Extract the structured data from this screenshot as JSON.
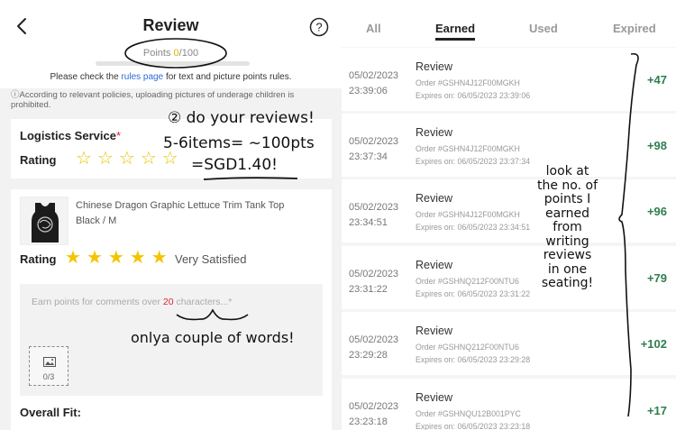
{
  "review_screen": {
    "title": "Review",
    "points_label": "Points",
    "points_value": "0",
    "points_max": "/100",
    "points_progress": 0,
    "rules_prefix": "Please check the",
    "rules_link": "rules page",
    "rules_suffix": "for text and picture points rules.",
    "notice": "ⓘAccording to relevant policies, uploading pictures of underage children is prohibited.",
    "logistics": {
      "label": "Logistics Service",
      "required": "*",
      "rating_label": "Rating",
      "stars": 0
    },
    "product": {
      "name": "Chinese Dragon Graphic Lettuce Trim Tank Top",
      "variant": "Black / M",
      "rating_label": "Rating",
      "stars": 5,
      "rating_text": "Very Satisfied",
      "comment_placeholder_prefix": "Earn points for comments over",
      "comment_placeholder_num": "20",
      "comment_placeholder_suffix": "characters...*",
      "upload_count": "0/3",
      "overall_fit": "Overall Fit:"
    }
  },
  "annotations": {
    "line1": "② do your reviews!",
    "line2": "5-6items= ~100pts",
    "line3": "=SGD1.40!",
    "line4": "onlya couple of words!",
    "note": [
      "look at",
      "the no. of",
      "points I",
      "earned",
      "from",
      "writing",
      "reviews",
      "in one",
      "seating!"
    ]
  },
  "points_history": {
    "tabs": [
      "All",
      "Earned",
      "Used",
      "Expired"
    ],
    "active_tab": "Earned",
    "rows": [
      {
        "date": "05/02/2023",
        "time": "23:39:06",
        "title": "Review",
        "order": "Order #GSHN4J12F00MGKH",
        "expires": "Expires on: 06/05/2023 23:39:06",
        "points": "+47"
      },
      {
        "date": "05/02/2023",
        "time": "23:37:34",
        "title": "Review",
        "order": "Order #GSHN4J12F00MGKH",
        "expires": "Expires on: 06/05/2023 23:37:34",
        "points": "+98"
      },
      {
        "date": "05/02/2023",
        "time": "23:34:51",
        "title": "Review",
        "order": "Order #GSHN4J12F00MGKH",
        "expires": "Expires on: 06/05/2023 23:34:51",
        "points": "+96"
      },
      {
        "date": "05/02/2023",
        "time": "23:31:22",
        "title": "Review",
        "order": "Order #GSHNQ212F00NTU6",
        "expires": "Expires on: 06/05/2023 23:31:22",
        "points": "+79"
      },
      {
        "date": "05/02/2023",
        "time": "23:29:28",
        "title": "Review",
        "order": "Order #GSHNQ212F00NTU6",
        "expires": "Expires on: 06/05/2023 23:29:28",
        "points": "+102"
      },
      {
        "date": "05/02/2023",
        "time": "23:23:18",
        "title": "Review",
        "order": "Order #GSHNQU12B001PYC",
        "expires": "Expires on: 06/05/2023 23:23:18",
        "points": "+17"
      }
    ]
  },
  "colors": {
    "accent_yellow": "#f5c400",
    "points_green": "#2e7d4f",
    "link_blue": "#2a6bd6",
    "required_red": "#dd2233"
  },
  "icons": [
    "back-arrow-icon",
    "help-icon",
    "star-icon",
    "image-upload-icon"
  ]
}
